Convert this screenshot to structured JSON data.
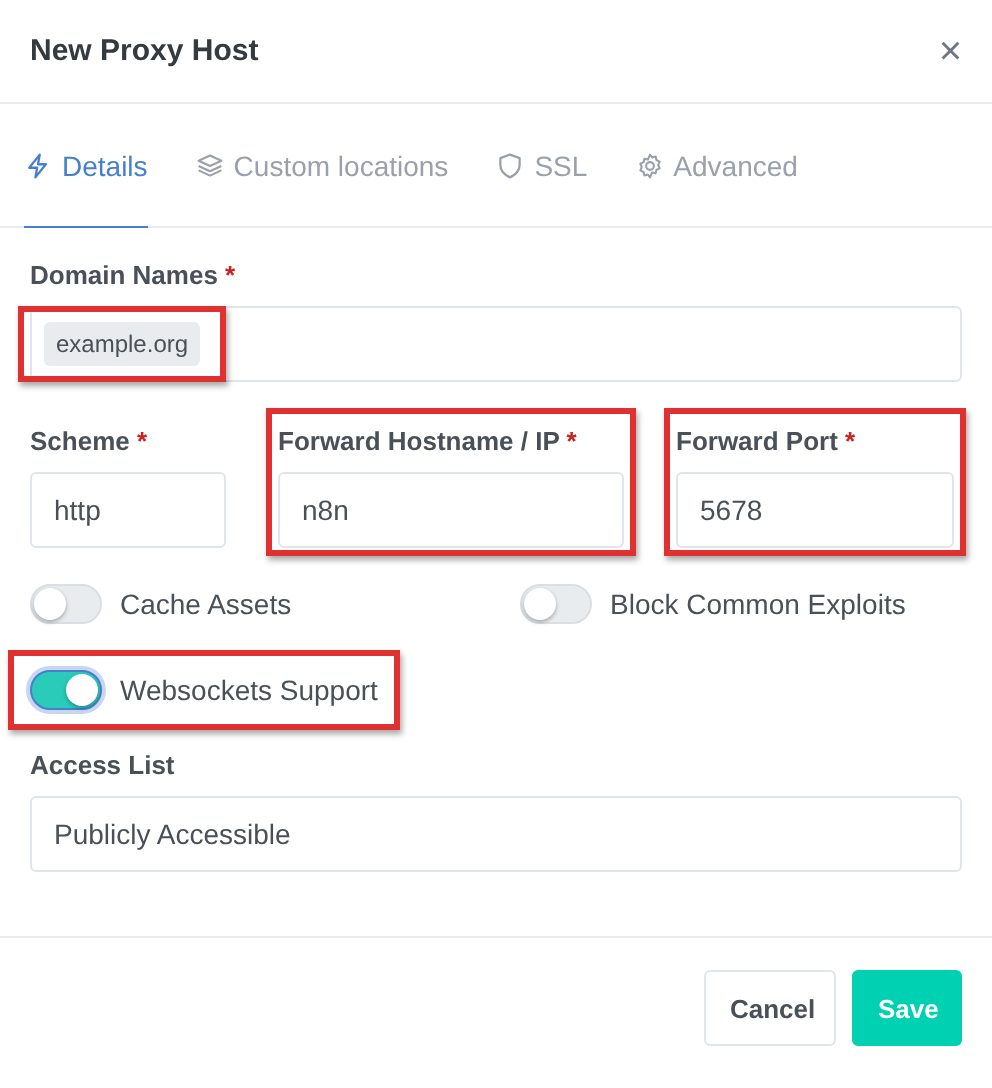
{
  "dialog": {
    "title": "New Proxy Host",
    "close": "×"
  },
  "tabs": [
    {
      "label": "Details",
      "selected": true
    },
    {
      "label": "Custom locations",
      "selected": false
    },
    {
      "label": "SSL",
      "selected": false
    },
    {
      "label": "Advanced",
      "selected": false
    }
  ],
  "domain_names": {
    "label": "Domain Names",
    "required_mark": "*",
    "tags": [
      {
        "text": "example.org",
        "highlighted": true
      }
    ]
  },
  "address_fields": [
    {
      "label": "Scheme",
      "required_mark": "*",
      "value": "http",
      "highlighted": false
    },
    {
      "label": "Forward Hostname / IP",
      "required_mark": "*",
      "value": "n8n",
      "highlighted": true
    },
    {
      "label": "Forward Port",
      "required_mark": "*",
      "value": "5678",
      "highlighted": true
    }
  ],
  "toggles": [
    {
      "label": "Cache Assets",
      "on": false,
      "highlighted": false
    },
    {
      "label": "Block Common Exploits",
      "on": false,
      "highlighted": false
    },
    {
      "label": "Websockets Support",
      "on": true,
      "highlighted": true
    }
  ],
  "access_list": {
    "label": "Access List",
    "value": "Publicly Accessible"
  },
  "buttons": [
    {
      "label": "Cancel",
      "kind": "secondary"
    },
    {
      "label": "Save",
      "kind": "primary"
    }
  ]
}
